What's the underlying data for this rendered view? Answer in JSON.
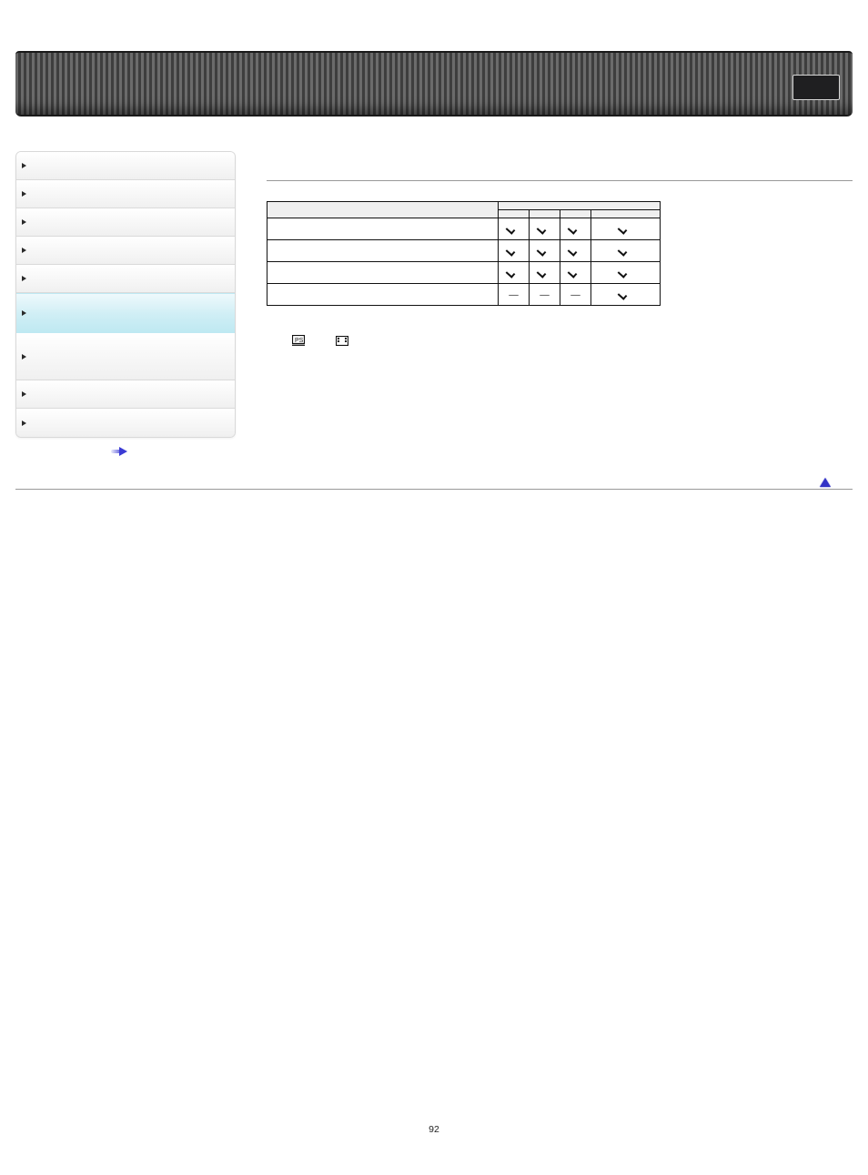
{
  "header_right_label": "",
  "sidemenu": {
    "items": [
      {
        "label": "",
        "active": false,
        "class": ""
      },
      {
        "label": "",
        "active": false,
        "class": ""
      },
      {
        "label": "",
        "active": false,
        "class": ""
      },
      {
        "label": "",
        "active": false,
        "class": ""
      },
      {
        "label": "",
        "active": false,
        "class": ""
      },
      {
        "label": "",
        "active": true,
        "class": "taller1"
      },
      {
        "label": "",
        "active": false,
        "class": "taller2"
      },
      {
        "label": "",
        "active": false,
        "class": ""
      },
      {
        "label": "",
        "active": false,
        "class": ""
      }
    ],
    "under_label": ""
  },
  "section": {
    "title": "",
    "subtitle": "",
    "body": ""
  },
  "table": {
    "head_group": "",
    "head_mode1": "",
    "head_mode2": "",
    "head_mode3": "",
    "head_mode4": "",
    "rows": [
      {
        "name": "",
        "cols": [
          "check",
          "check",
          "check",
          "check"
        ]
      },
      {
        "name": "",
        "cols": [
          "check",
          "check",
          "check",
          "check"
        ]
      },
      {
        "name": "",
        "cols": [
          "check",
          "check",
          "check",
          "check"
        ]
      },
      {
        "name": "",
        "cols": [
          "dash",
          "dash",
          "dash",
          "check"
        ]
      }
    ]
  },
  "note": {
    "prefix": "",
    "icon1_label": "",
    "icon2_label": ""
  },
  "to_top_label": "",
  "page_number": "92"
}
